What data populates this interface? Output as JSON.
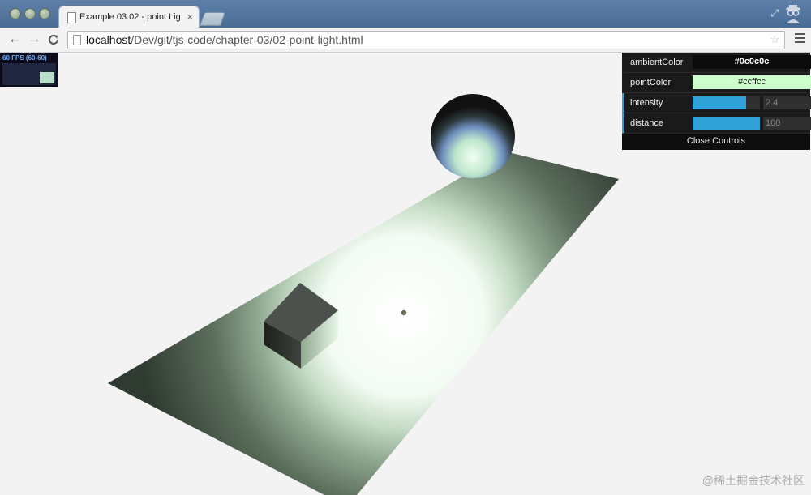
{
  "browser": {
    "tab_title": "Example 03.02 - point Lig",
    "tab_close": "×",
    "url_host": "localhost",
    "url_path": "/Dev/git/tjs-code/chapter-03/02-point-light.html",
    "back": "←",
    "forward": "→",
    "reload": "C"
  },
  "stats": {
    "fps_text": "60 FPS (60-60)",
    "fps_value": 60
  },
  "controls": {
    "ambient_label": "ambientColor",
    "ambient_value": "#0c0c0c",
    "point_label": "pointColor",
    "point_value": "#ccffcc",
    "intensity_label": "intensity",
    "intensity_value": "2.4",
    "intensity_fraction": 0.8,
    "distance_label": "distance",
    "distance_value": "100",
    "distance_fraction": 1.0,
    "close_label": "Close Controls"
  },
  "colors": {
    "ambient": "#0c0c0c",
    "point_light": "#ccffcc",
    "slider_fill": "#2fa1d6"
  },
  "watermark": "@稀土掘金技术社区"
}
